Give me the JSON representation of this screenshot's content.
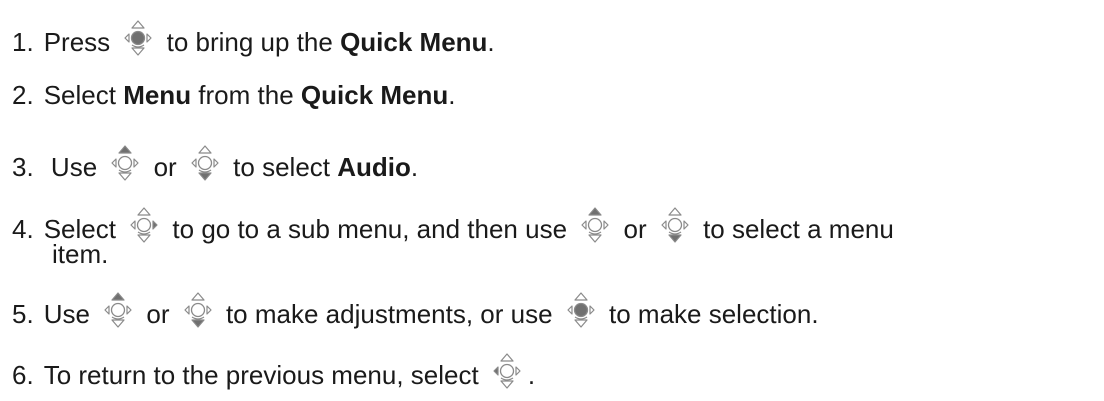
{
  "steps": [
    {
      "num": "1.",
      "parts": [
        {
          "t": "text",
          "v": "Press "
        },
        {
          "t": "icon",
          "icon": "center-press-icon"
        },
        {
          "t": "text",
          "v": " to bring up the "
        },
        {
          "t": "bold",
          "v": "Quick Menu"
        },
        {
          "t": "text",
          "v": "."
        }
      ]
    },
    {
      "num": "2.",
      "parts": [
        {
          "t": "text",
          "v": "Select "
        },
        {
          "t": "bold",
          "v": "Menu"
        },
        {
          "t": "text",
          "v": " from the "
        },
        {
          "t": "bold",
          "v": "Quick Menu"
        },
        {
          "t": "text",
          "v": "."
        }
      ]
    },
    {
      "num": "3.",
      "parts": [
        {
          "t": "text",
          "v": " Use "
        },
        {
          "t": "icon",
          "icon": "up-arrow-icon"
        },
        {
          "t": "text",
          "v": " or "
        },
        {
          "t": "icon",
          "icon": "down-arrow-icon"
        },
        {
          "t": "text",
          "v": " to select "
        },
        {
          "t": "bold",
          "v": "Audio"
        },
        {
          "t": "text",
          "v": "."
        }
      ]
    },
    {
      "num": "4.",
      "parts": [
        {
          "t": "text",
          "v": "Select "
        },
        {
          "t": "icon",
          "icon": "right-arrow-icon"
        },
        {
          "t": "text",
          "v": " to go to a sub menu, and then use "
        },
        {
          "t": "icon",
          "icon": "up-arrow-icon"
        },
        {
          "t": "text",
          "v": " or "
        },
        {
          "t": "icon",
          "icon": "down-arrow-icon"
        },
        {
          "t": "text",
          "v": " to select a menu"
        }
      ],
      "continuation": "item."
    },
    {
      "num": "5.",
      "parts": [
        {
          "t": "text",
          "v": "Use "
        },
        {
          "t": "icon",
          "icon": "up-arrow-icon"
        },
        {
          "t": "text",
          "v": " or "
        },
        {
          "t": "icon",
          "icon": "down-arrow-icon"
        },
        {
          "t": "text",
          "v": " to make adjustments, or use "
        },
        {
          "t": "icon",
          "icon": "center-press-icon"
        },
        {
          "t": "text",
          "v": " to make selection."
        }
      ]
    },
    {
      "num": "6.",
      "parts": [
        {
          "t": "text",
          "v": "To return to the previous menu, select "
        },
        {
          "t": "icon",
          "icon": "left-arrow-icon"
        },
        {
          "t": "text",
          "v": "."
        }
      ]
    }
  ],
  "icon_color": "#8a8a8a",
  "icon_fill": "#707070"
}
